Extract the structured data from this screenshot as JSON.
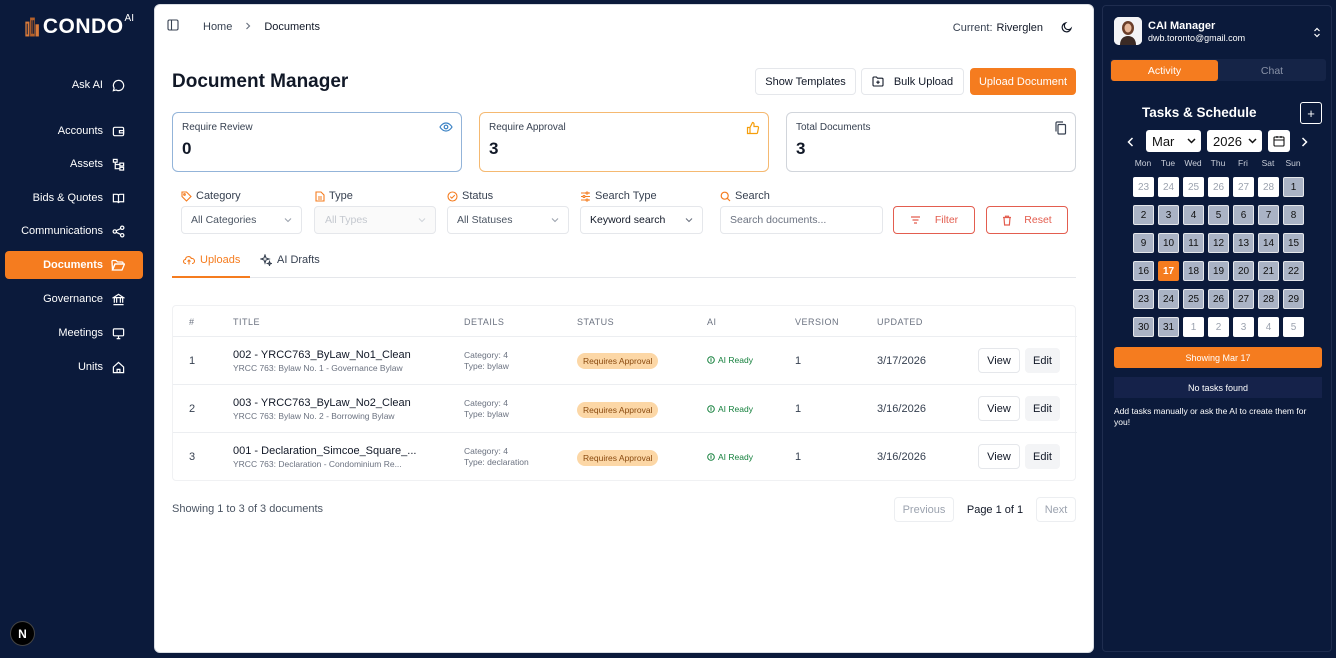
{
  "brand": {
    "name": "CONDO",
    "sup": "AI"
  },
  "sidebar": {
    "items": [
      {
        "label": "Ask AI",
        "icon": "chat-icon"
      },
      {
        "label": "Accounts",
        "icon": "wallet-icon"
      },
      {
        "label": "Assets",
        "icon": "tree-icon"
      },
      {
        "label": "Bids & Quotes",
        "icon": "book-icon"
      },
      {
        "label": "Communications",
        "icon": "share-icon"
      },
      {
        "label": "Documents",
        "icon": "folder-icon",
        "active": true
      },
      {
        "label": "Governance",
        "icon": "bank-icon"
      },
      {
        "label": "Meetings",
        "icon": "monitor-icon"
      },
      {
        "label": "Units",
        "icon": "home-icon"
      }
    ],
    "bottom_badge": "N"
  },
  "header": {
    "breadcrumb": [
      "Home",
      "Documents"
    ],
    "current_label": "Current:",
    "current_value": "Riverglen"
  },
  "page": {
    "title": "Document Manager",
    "buttons": {
      "templates": "Show Templates",
      "bulk": "Bulk Upload",
      "upload": "Upload Document"
    }
  },
  "cards": [
    {
      "label": "Require Review",
      "value": "0"
    },
    {
      "label": "Require Approval",
      "value": "3"
    },
    {
      "label": "Total Documents",
      "value": "3"
    }
  ],
  "filters": {
    "category": {
      "label": "Category",
      "value": "All Categories"
    },
    "type": {
      "label": "Type",
      "value": "All Types"
    },
    "status": {
      "label": "Status",
      "value": "All Statuses"
    },
    "search_type": {
      "label": "Search Type",
      "value": "Keyword search"
    },
    "search": {
      "label": "Search",
      "placeholder": "Search documents..."
    },
    "filter_btn": "Filter",
    "reset_btn": "Reset"
  },
  "tabs": {
    "uploads": "Uploads",
    "drafts": "AI Drafts"
  },
  "table": {
    "headers": [
      "#",
      "TITLE",
      "DETAILS",
      "STATUS",
      "AI",
      "VERSION",
      "UPDATED"
    ],
    "rows": [
      {
        "num": "1",
        "title": "002 - YRCC763_ByLaw_No1_Clean",
        "subtitle": "YRCC 763: Bylaw No. 1 - Governance Bylaw",
        "cat": "Category: 4",
        "type": "Type: bylaw",
        "status": "Requires Approval",
        "ai": "AI Ready",
        "version": "1",
        "updated": "3/17/2026",
        "view": "View",
        "edit": "Edit"
      },
      {
        "num": "2",
        "title": "003 - YRCC763_ByLaw_No2_Clean",
        "subtitle": "YRCC 763: Bylaw No. 2 - Borrowing Bylaw",
        "cat": "Category: 4",
        "type": "Type: bylaw",
        "status": "Requires Approval",
        "ai": "AI Ready",
        "version": "1",
        "updated": "3/16/2026",
        "view": "View",
        "edit": "Edit"
      },
      {
        "num": "3",
        "title": "001 - Declaration_Simcoe_Square_...",
        "subtitle": "YRCC 763: Declaration - Condominium Re...",
        "cat": "Category: 4",
        "type": "Type: declaration",
        "status": "Requires Approval",
        "ai": "AI Ready",
        "version": "1",
        "updated": "3/16/2026",
        "view": "View",
        "edit": "Edit"
      }
    ]
  },
  "pagination": {
    "showing": "Showing 1 to 3 of 3 documents",
    "prev": "Previous",
    "page": "Page 1 of 1",
    "next": "Next"
  },
  "panel": {
    "user": {
      "name": "CAI Manager",
      "email": "dwb.toronto@gmail.com"
    },
    "tabs": {
      "activity": "Activity",
      "chat": "Chat"
    },
    "title": "Tasks & Schedule",
    "plus": "+",
    "calendar": {
      "month": "Mar",
      "year": "2026",
      "weekdays": [
        "Mon",
        "Tue",
        "Wed",
        "Thu",
        "Fri",
        "Sat",
        "Sun"
      ],
      "weeks": [
        [
          "23",
          "24",
          "25",
          "26",
          "27",
          "28",
          "1"
        ],
        [
          "2",
          "3",
          "4",
          "5",
          "6",
          "7",
          "8"
        ],
        [
          "9",
          "10",
          "11",
          "12",
          "13",
          "14",
          "15"
        ],
        [
          "16",
          "17",
          "18",
          "19",
          "20",
          "21",
          "22"
        ],
        [
          "23",
          "24",
          "25",
          "26",
          "27",
          "28",
          "29"
        ],
        [
          "30",
          "31",
          "1",
          "2",
          "3",
          "4",
          "5"
        ]
      ],
      "selected": "17"
    },
    "showing": "Showing Mar 17",
    "empty": "No tasks found",
    "hint": "Add tasks manually or ask the AI to create them for you!"
  }
}
